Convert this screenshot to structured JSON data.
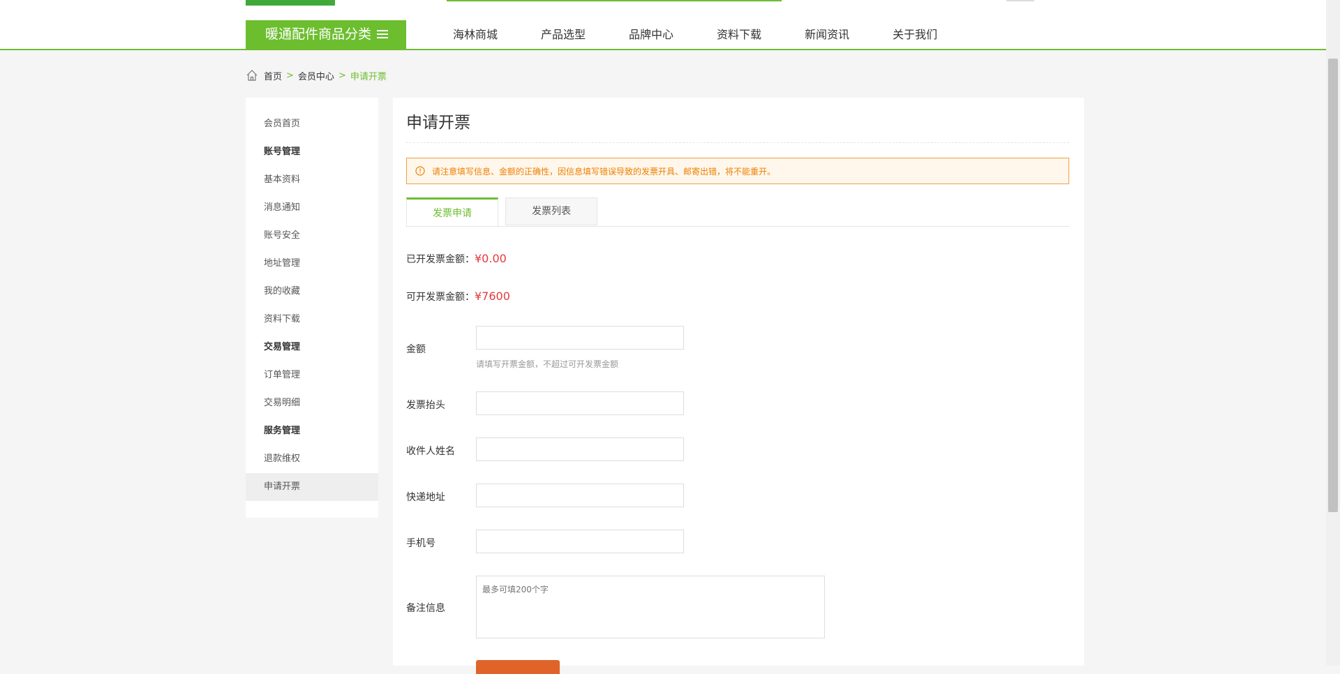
{
  "header": {
    "category_label": "暖通配件商品分类",
    "nav": [
      "海林商城",
      "产品选型",
      "品牌中心",
      "资料下载",
      "新闻资讯",
      "关于我们"
    ]
  },
  "breadcrumb": {
    "home": "首页",
    "sep": ">",
    "member": "会员中心",
    "current": "申请开票"
  },
  "sidebar": {
    "items": [
      {
        "label": "会员首页",
        "bold": false
      },
      {
        "label": "账号管理",
        "bold": true
      },
      {
        "label": "基本资料",
        "bold": false
      },
      {
        "label": "消息通知",
        "bold": false
      },
      {
        "label": "账号安全",
        "bold": false
      },
      {
        "label": "地址管理",
        "bold": false
      },
      {
        "label": "我的收藏",
        "bold": false
      },
      {
        "label": "资料下载",
        "bold": false
      },
      {
        "label": "交易管理",
        "bold": true
      },
      {
        "label": "订单管理",
        "bold": false
      },
      {
        "label": "交易明细",
        "bold": false
      },
      {
        "label": "服务管理",
        "bold": true
      },
      {
        "label": "退款维权",
        "bold": false
      },
      {
        "label": "申请开票",
        "bold": false,
        "active": true
      }
    ]
  },
  "main": {
    "title": "申请开票",
    "notice": "请注意填写信息、金额的正确性，因信息填写错误导致的发票开具、邮寄出错，将不能重开。",
    "tabs": [
      "发票申请",
      "发票列表"
    ],
    "issued_label": "已开发票金额：",
    "issued_value": "¥0.00",
    "available_label": "可开发票金额：",
    "available_value": "¥7600",
    "form": {
      "amount_label": "金额",
      "amount_hint": "请填写开票金额，不超过可开发票金额",
      "title_label": "发票抬头",
      "name_label": "收件人姓名",
      "address_label": "快递地址",
      "phone_label": "手机号",
      "remark_label": "备注信息",
      "remark_placeholder": "最多可填200个字"
    }
  },
  "colors": {
    "brand_green": "#6cbe2f",
    "price_red": "#e4393c",
    "notice_orange": "#ee7f00",
    "submit_orange": "#e0642a"
  }
}
